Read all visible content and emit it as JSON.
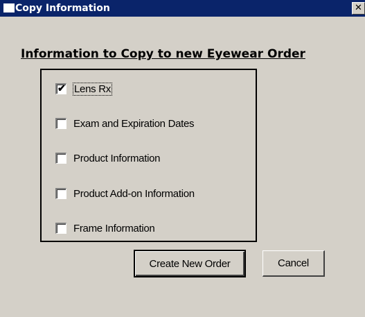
{
  "window": {
    "title": "Copy Information",
    "close_glyph": "✕"
  },
  "heading": "Information to Copy to new Eyewear Order",
  "options": [
    {
      "label": "Lens Rx",
      "checked": true
    },
    {
      "label": "Exam and Expiration Dates",
      "checked": false
    },
    {
      "label": "Product Information",
      "checked": false
    },
    {
      "label": "Product Add-on Information",
      "checked": false
    },
    {
      "label": "Frame Information",
      "checked": false
    }
  ],
  "buttons": {
    "create_label": "Create New Order",
    "cancel_label": "Cancel"
  },
  "colors": {
    "titlebar": "#0a246a",
    "dialog_bg": "#d4d0c8"
  }
}
